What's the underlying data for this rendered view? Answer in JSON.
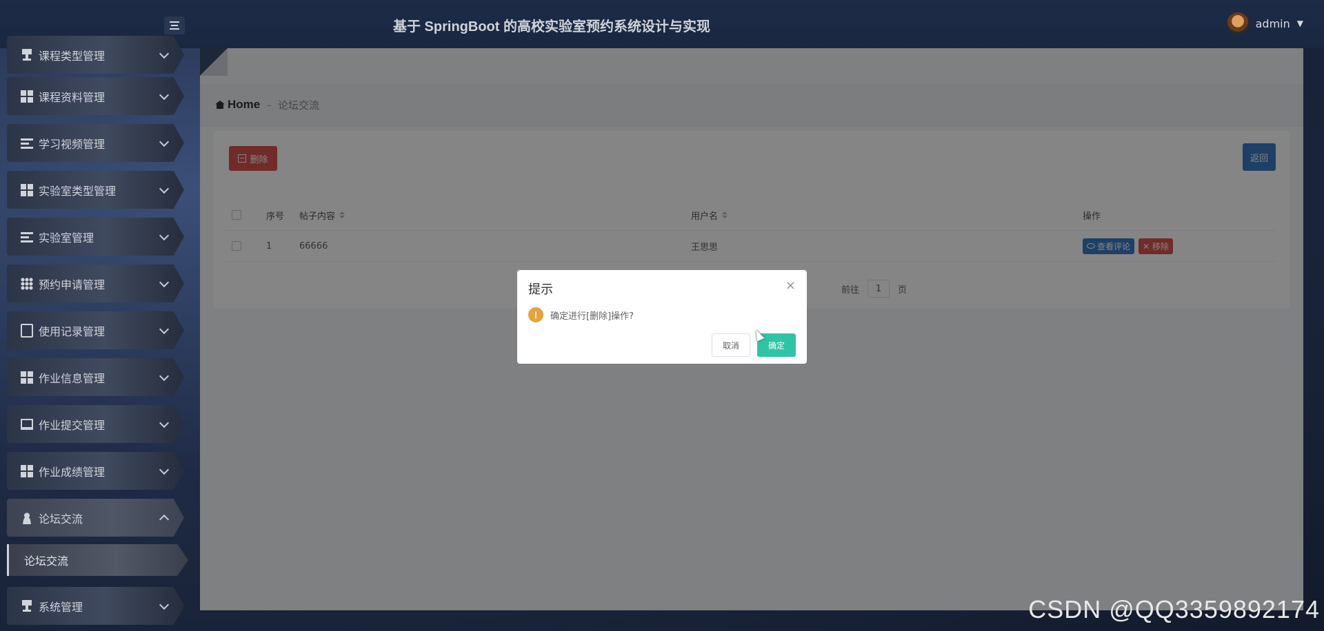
{
  "header": {
    "site_title": "基于 SpringBoot 的高校实验室预约系统设计与实现",
    "username": "admin"
  },
  "sidebar": {
    "items": [
      {
        "label": "课程类型管理",
        "icon": "trophy-icon"
      },
      {
        "label": "课程资料管理",
        "icon": "grid-icon"
      },
      {
        "label": "学习视频管理",
        "icon": "list-icon"
      },
      {
        "label": "实验室类型管理",
        "icon": "grid-icon"
      },
      {
        "label": "实验室管理",
        "icon": "list-icon"
      },
      {
        "label": "预约申请管理",
        "icon": "th-icon"
      },
      {
        "label": "使用记录管理",
        "icon": "clipboard-icon"
      },
      {
        "label": "作业信息管理",
        "icon": "grid-icon"
      },
      {
        "label": "作业提交管理",
        "icon": "monitor-icon"
      },
      {
        "label": "作业成绩管理",
        "icon": "grid-icon"
      },
      {
        "label": "论坛交流",
        "icon": "user-icon"
      },
      {
        "label": "系统管理",
        "icon": "trophy-icon"
      }
    ],
    "sub_item": "论坛交流"
  },
  "breadcrumb": {
    "home": "Home",
    "separator": "-",
    "current": "论坛交流"
  },
  "toolbar": {
    "delete_label": "删除",
    "back_label": "返回"
  },
  "table": {
    "headers": {
      "no": "序号",
      "content": "帖子内容",
      "user": "用户名",
      "op": "操作"
    },
    "rows": [
      {
        "no": "1",
        "content": "66666",
        "user": "王思思",
        "view_label": "查看评论",
        "remove_label": "移除"
      }
    ]
  },
  "pager": {
    "goto_label": "前往",
    "page": "1",
    "page_unit": "页"
  },
  "dialog": {
    "title": "提示",
    "close": "×",
    "warn_glyph": "!",
    "message": "确定进行[删除]操作?",
    "cancel_label": "取消",
    "ok_label": "确定"
  },
  "watermark": "CSDN @QQ3359892174",
  "colors": {
    "danger": "#d9534f",
    "primary": "#3c7cc4",
    "confirm": "#2ec4a4",
    "warning": "#e6a23c"
  }
}
